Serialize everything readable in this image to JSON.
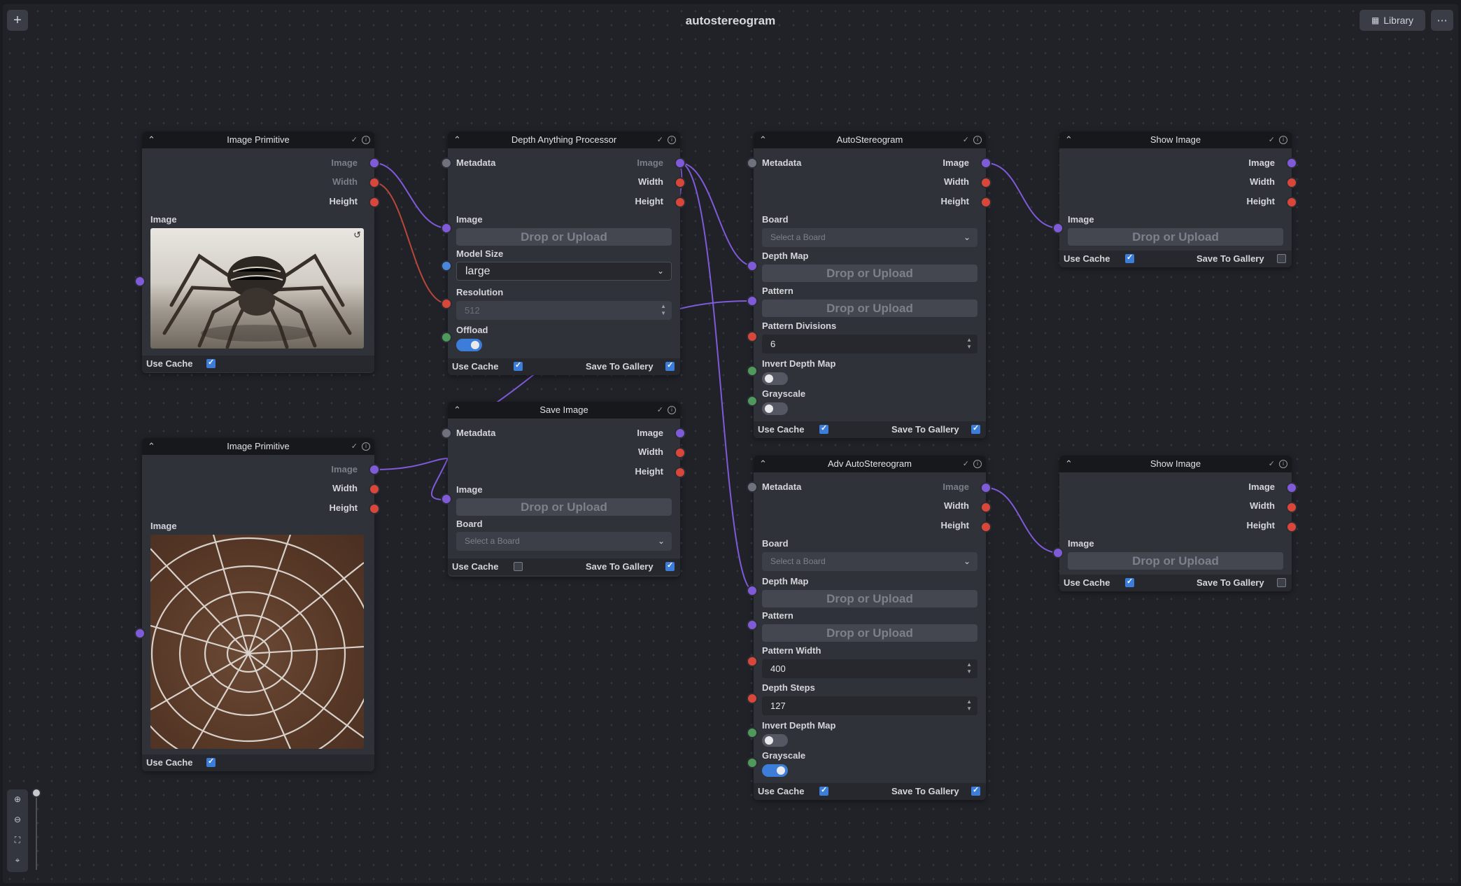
{
  "app": {
    "title": "autostereogram",
    "add_label": "+",
    "library_label": "Library",
    "more_label": "⋯"
  },
  "labels": {
    "image": "Image",
    "width": "Width",
    "height": "Height",
    "metadata": "Metadata",
    "drop": "Drop or Upload",
    "use_cache": "Use Cache",
    "save_to_gallery": "Save To Gallery",
    "board": "Board",
    "select_board": "Select a Board",
    "depth_map": "Depth Map",
    "pattern": "Pattern",
    "invert_depth_map": "Invert Depth Map",
    "grayscale": "Grayscale"
  },
  "nodes": {
    "prim1": {
      "title": "Image Primitive",
      "use_cache": true
    },
    "prim2": {
      "title": "Image Primitive",
      "use_cache": true
    },
    "depth": {
      "title": "Depth Anything Processor",
      "model_size_label": "Model Size",
      "model_size": "large",
      "resolution_label": "Resolution",
      "resolution": "512",
      "offload_label": "Offload",
      "offload": true,
      "use_cache": true,
      "save_to_gallery": true
    },
    "save": {
      "title": "Save Image",
      "use_cache": false,
      "save_to_gallery": true
    },
    "auto": {
      "title": "AutoStereogram",
      "pattern_divisions_label": "Pattern Divisions",
      "pattern_divisions": "6",
      "invert_depth_map": false,
      "grayscale": false,
      "use_cache": true,
      "save_to_gallery": true
    },
    "adv": {
      "title": "Adv AutoStereogram",
      "pattern_width_label": "Pattern Width",
      "pattern_width": "400",
      "depth_steps_label": "Depth Steps",
      "depth_steps": "127",
      "invert_depth_map": false,
      "grayscale": true,
      "use_cache": true,
      "save_to_gallery": true
    },
    "show1": {
      "title": "Show Image",
      "use_cache": true,
      "save_to_gallery": false
    },
    "show2": {
      "title": "Show Image",
      "use_cache": true,
      "save_to_gallery": false
    }
  },
  "colors": {
    "image_handle": "#7f5ad9",
    "number_handle": "#d9473a",
    "metadata_handle": "#6f727c",
    "boolean_handle": "#4f9a5a",
    "string_handle": "#4a86d9",
    "accent": "#3b7dd8"
  },
  "icons": {
    "zoom_in": "zoom-in-icon",
    "zoom_out": "zoom-out-icon",
    "fit_view": "fit-view-icon",
    "minimap": "map-pin-icon"
  }
}
